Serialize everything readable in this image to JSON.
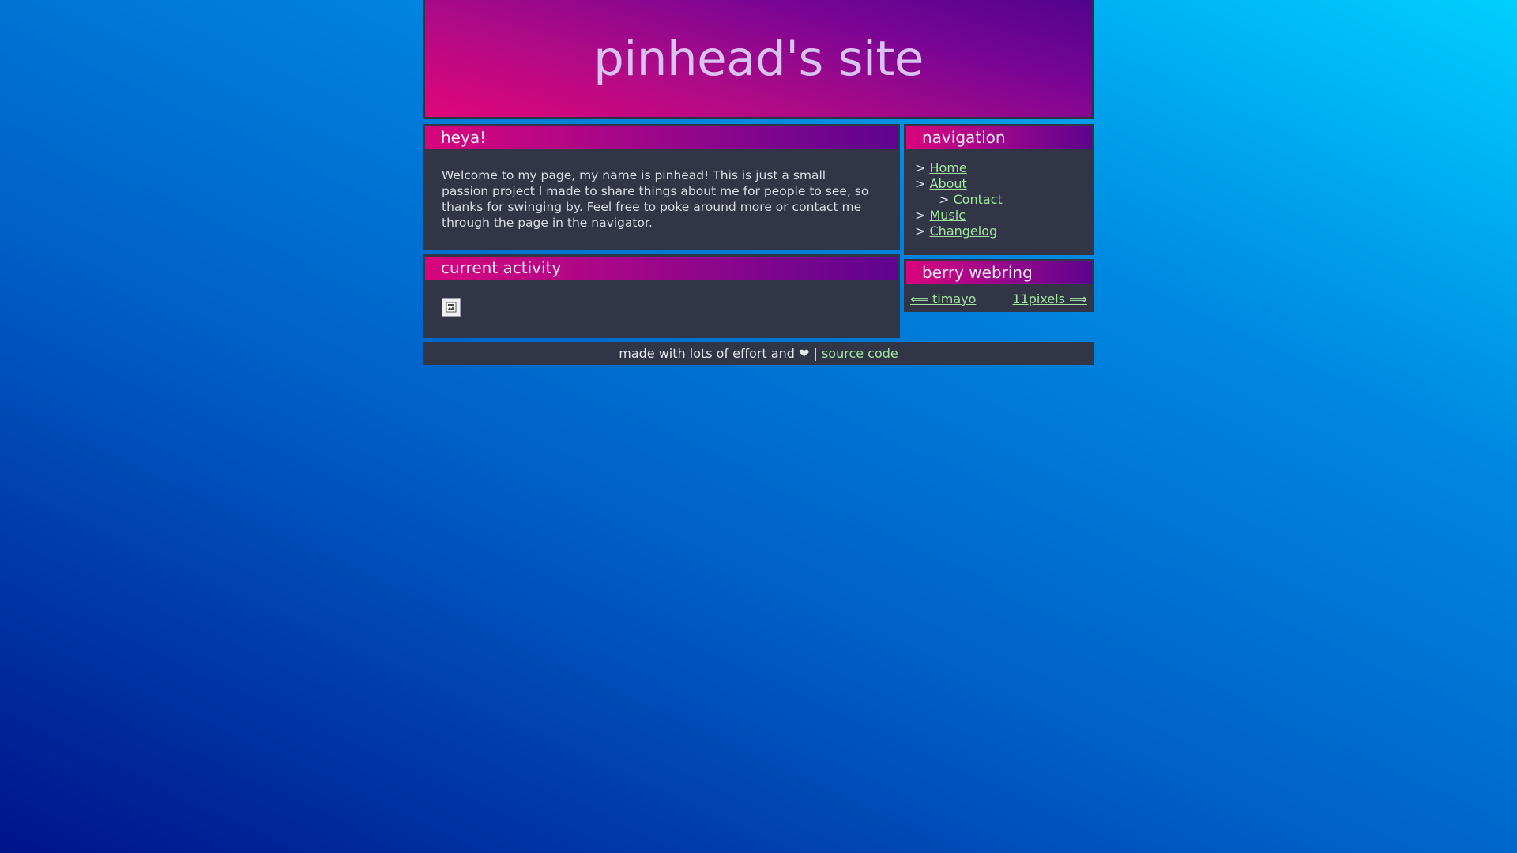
{
  "site": {
    "title": "pinhead's site"
  },
  "heya": {
    "title": "heya!",
    "text": "Welcome to my page, my name is pinhead! This is just a small passion project I made to share things about me for people to see, so thanks for swinging by. Feel free to poke around more or contact me through the page in the navigator."
  },
  "activity": {
    "title": "current activity",
    "image_icon": "broken-image-icon"
  },
  "navigation": {
    "title": "navigation",
    "arrow": ">",
    "items": [
      {
        "label": "Home"
      },
      {
        "label": "About"
      },
      {
        "label": "Contact"
      },
      {
        "label": "Music"
      },
      {
        "label": "Changelog"
      }
    ]
  },
  "webring": {
    "title": "berry webring",
    "prev_label": "⟸ timayo",
    "next_label": "11pixels ⟹"
  },
  "footer": {
    "text": "made with lots of effort and",
    "heart": "❤",
    "separator": "|",
    "link_label": "source code"
  },
  "colors": {
    "link": "#a3e6a0",
    "panel": "#323546",
    "title_pink": "#d8057c",
    "title_purple": "#5d048f",
    "site_title": "#d8c3f2"
  }
}
